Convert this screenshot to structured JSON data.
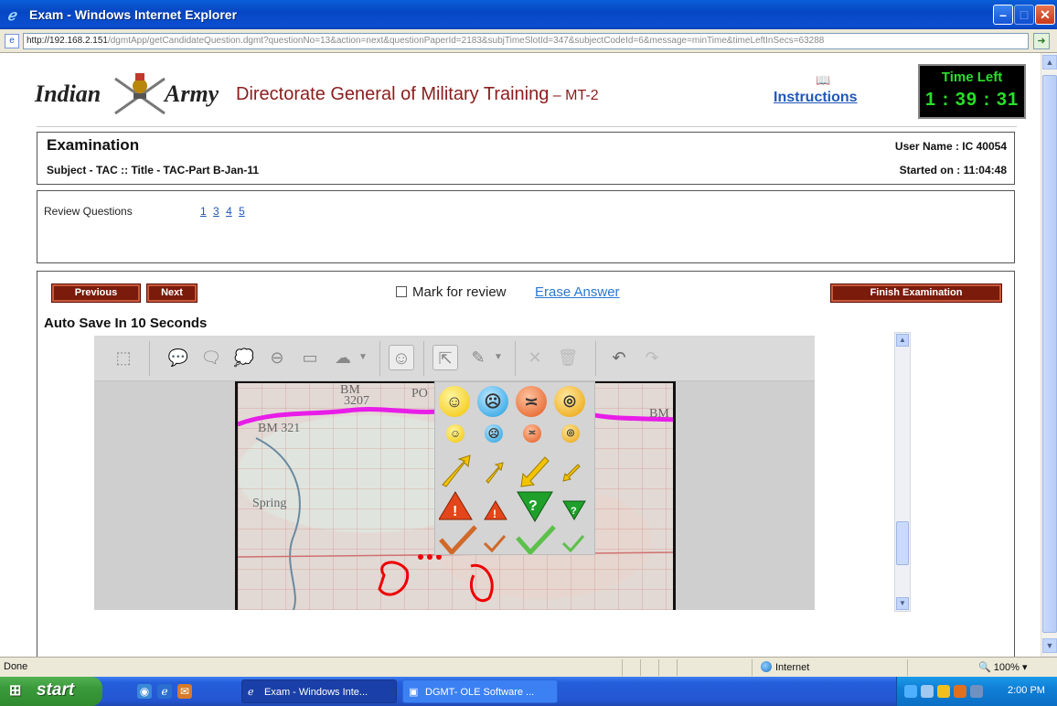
{
  "window": {
    "title": "Exam - Windows Internet Explorer",
    "url_host": "http://192.168.2.151",
    "url_path": "/dgmtApp/getCandidateQuestion.dgmt?questionNo=13&action=next&questionPaperId=2183&subjTimeSlotId=347&subjectCodeId=6&message=minTime&timeLeftInSecs=63288"
  },
  "header": {
    "logo_left": "Indian",
    "logo_right": "Army",
    "org": "Directorate General of Military Training",
    "org_suffix": " – MT-2",
    "instructions": "Instructions",
    "time_left_label": "Time Left",
    "time_left": "1 : 39 : 31"
  },
  "exam": {
    "title": "Examination",
    "subject": "Subject - TAC :: Title - TAC-Part B-Jan-11",
    "user": "User Name : IC 40054",
    "started": "Started on : 11:04:48"
  },
  "review": {
    "label": "Review Questions",
    "questions": [
      "1",
      "3",
      "4",
      "5"
    ]
  },
  "question": {
    "previous": "Previous",
    "next": "Next",
    "mark_review": "Mark for review",
    "erase": "Erase Answer",
    "finish": "Finish Examination",
    "autosave": "Auto Save In 10 Seconds"
  },
  "map": {
    "label_bm": "BM",
    "label_bm2": "3207",
    "label_po": "PO",
    "label_bm321": "BM 321",
    "label_spring": "Spring",
    "label_bm_right": "BM"
  },
  "status": {
    "text": "Done",
    "zone": "Internet",
    "zoom": "100%"
  },
  "taskbar": {
    "start": "start",
    "task1": "Exam - Windows Inte...",
    "task2": "DGMT- OLE Software ...",
    "clock": "2:00 PM"
  }
}
